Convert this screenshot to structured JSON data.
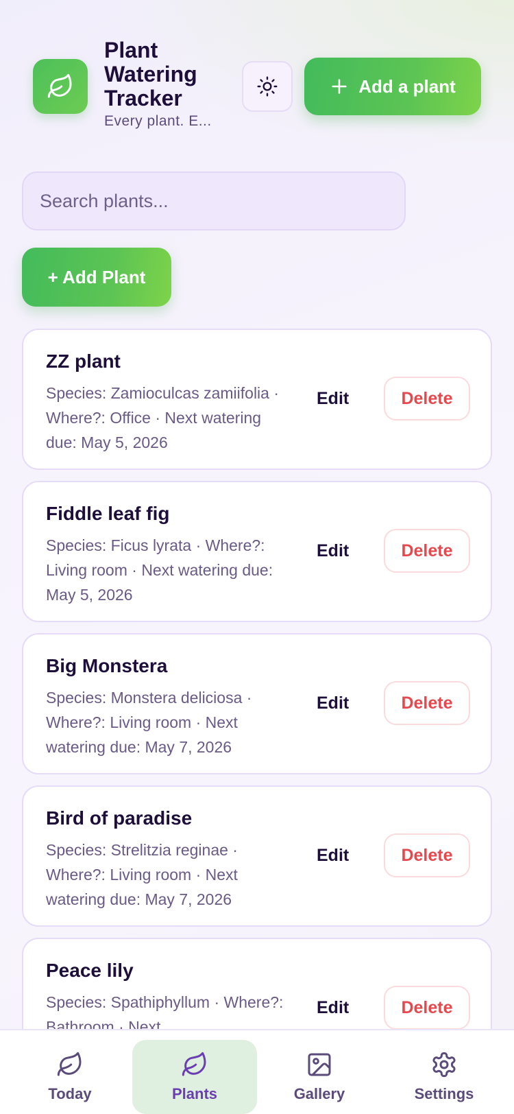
{
  "header": {
    "title": "Plant Watering Tracker",
    "subtitle": "Every plant. E...",
    "add_button_label": "Add a plant"
  },
  "search": {
    "placeholder": "Search plants..."
  },
  "add_plant_label": "+ Add Plant",
  "plants": [
    {
      "name": "ZZ plant",
      "meta": "Species: Zamioculcas zamiifolia · Where?: Office · Next watering due: May 5, 2026"
    },
    {
      "name": "Fiddle leaf fig",
      "meta": "Species: Ficus lyrata · Where?: Living room · Next watering due: May 5, 2026"
    },
    {
      "name": "Big Monstera",
      "meta": "Species: Monstera deliciosa · Where?: Living room · Next watering due: May 7, 2026"
    },
    {
      "name": "Bird of paradise",
      "meta": "Species: Strelitzia reginae · Where?: Living room · Next watering due: May 7, 2026"
    },
    {
      "name": "Peace lily",
      "meta": "Species: Spathiphyllum · Where?: Bathroom · Next"
    }
  ],
  "card_actions": {
    "edit": "Edit",
    "delete": "Delete"
  },
  "nav": [
    {
      "label": "Today",
      "icon": "leaf-icon"
    },
    {
      "label": "Plants",
      "icon": "leaf-icon",
      "active": true
    },
    {
      "label": "Gallery",
      "icon": "image-icon"
    },
    {
      "label": "Settings",
      "icon": "gear-icon"
    }
  ],
  "colors": {
    "accent_green": "#4cc05a",
    "delete_red": "#e5484d",
    "active_nav_bg": "#dff0e0",
    "active_nav_text": "#6a3db0"
  }
}
